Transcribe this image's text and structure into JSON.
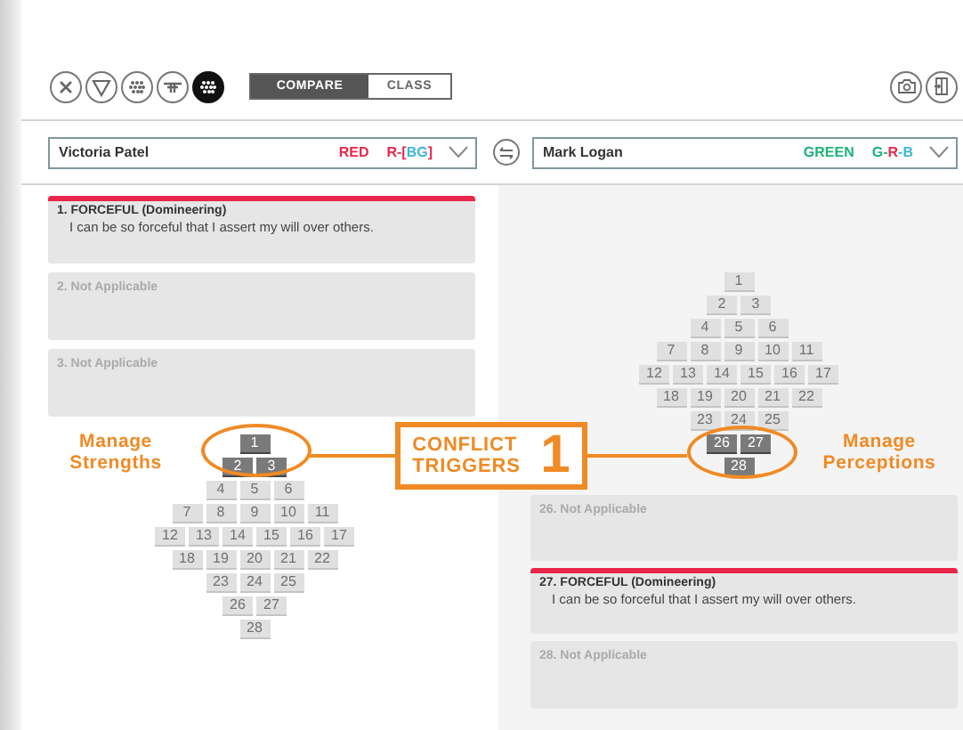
{
  "toolbar": {
    "filter_icons": [
      {
        "kind": "cross",
        "selected": false
      },
      {
        "kind": "triangle",
        "selected": false
      },
      {
        "kind": "cluster",
        "selected": false
      },
      {
        "kind": "bar",
        "selected": false
      },
      {
        "kind": "cluster",
        "selected": true
      }
    ],
    "view_tabs": [
      {
        "label": "COMPARE",
        "selected": true
      },
      {
        "label": "CLASS",
        "selected": false
      }
    ]
  },
  "people": [
    {
      "name": "Victoria Patel",
      "color_name": "RED",
      "color": "#e8264a",
      "code": [
        {
          "text": "R-[",
          "color": "#e8264a"
        },
        {
          "text": "BG",
          "color": "#3fb6e0"
        },
        {
          "text": "]",
          "color": "#e8264a"
        }
      ]
    },
    {
      "name": "Mark Logan",
      "color_name": "GREEN",
      "color": "#1db37a",
      "code": [
        {
          "text": "G-",
          "color": "#1db37a"
        },
        {
          "text": "R",
          "color": "#e8264a"
        },
        {
          "text": "-B",
          "color": "#3fb6e0"
        }
      ]
    }
  ],
  "left_panel": {
    "statements": [
      {
        "heading": "1. FORCEFUL (Domineering)",
        "body": "I can be so forceful that I assert my will over others.",
        "selected": true
      },
      {
        "heading": "2. Not Applicable",
        "selected": false
      },
      {
        "heading": "3. Not Applicable",
        "selected": false
      }
    ],
    "label": "Manage Strengths",
    "pyramid": [
      [
        {
          "label": "1",
          "selected": true
        }
      ],
      [
        {
          "label": "2",
          "selected": true
        },
        {
          "label": "3",
          "selected": true
        }
      ],
      [
        {
          "label": "4",
          "selected": false
        },
        {
          "label": "5",
          "selected": false
        },
        {
          "label": "6",
          "selected": false
        }
      ],
      [
        {
          "label": "7",
          "selected": false
        },
        {
          "label": "8",
          "selected": false
        },
        {
          "label": "9",
          "selected": false
        },
        {
          "label": "10",
          "selected": false
        },
        {
          "label": "11",
          "selected": false
        }
      ],
      [
        {
          "label": "12",
          "selected": false
        },
        {
          "label": "13",
          "selected": false
        },
        {
          "label": "14",
          "selected": false
        },
        {
          "label": "15",
          "selected": false
        },
        {
          "label": "16",
          "selected": false
        },
        {
          "label": "17",
          "selected": false
        }
      ],
      [
        {
          "label": "18",
          "selected": false
        },
        {
          "label": "19",
          "selected": false
        },
        {
          "label": "20",
          "selected": false
        },
        {
          "label": "21",
          "selected": false
        },
        {
          "label": "22",
          "selected": false
        }
      ],
      [
        {
          "label": "23",
          "selected": false
        },
        {
          "label": "24",
          "selected": false
        },
        {
          "label": "25",
          "selected": false
        }
      ],
      [
        {
          "label": "26",
          "selected": false
        },
        {
          "label": "27",
          "selected": false
        }
      ],
      [
        {
          "label": "28",
          "selected": false
        }
      ]
    ]
  },
  "conflict_triggers": {
    "label": "CONFLICT TRIGGERS",
    "count": "1"
  },
  "right_panel": {
    "label": "Manage Perceptions",
    "pyramid": [
      [
        {
          "label": "1",
          "selected": false
        }
      ],
      [
        {
          "label": "2",
          "selected": false
        },
        {
          "label": "3",
          "selected": false
        }
      ],
      [
        {
          "label": "4",
          "selected": false
        },
        {
          "label": "5",
          "selected": false
        },
        {
          "label": "6",
          "selected": false
        }
      ],
      [
        {
          "label": "7",
          "selected": false
        },
        {
          "label": "8",
          "selected": false
        },
        {
          "label": "9",
          "selected": false
        },
        {
          "label": "10",
          "selected": false
        },
        {
          "label": "11",
          "selected": false
        }
      ],
      [
        {
          "label": "12",
          "selected": false
        },
        {
          "label": "13",
          "selected": false
        },
        {
          "label": "14",
          "selected": false
        },
        {
          "label": "15",
          "selected": false
        },
        {
          "label": "16",
          "selected": false
        },
        {
          "label": "17",
          "selected": false
        }
      ],
      [
        {
          "label": "18",
          "selected": false
        },
        {
          "label": "19",
          "selected": false
        },
        {
          "label": "20",
          "selected": false
        },
        {
          "label": "21",
          "selected": false
        },
        {
          "label": "22",
          "selected": false
        }
      ],
      [
        {
          "label": "23",
          "selected": false
        },
        {
          "label": "24",
          "selected": false
        },
        {
          "label": "25",
          "selected": false
        }
      ],
      [
        {
          "label": "26",
          "selected": true
        },
        {
          "label": "27",
          "selected": true
        }
      ],
      [
        {
          "label": "28",
          "selected": true
        }
      ]
    ],
    "statements": [
      {
        "heading": "26. Not Applicable",
        "selected": false
      },
      {
        "heading": "27. FORCEFUL (Domineering)",
        "body": "I can be so forceful that I assert my will over others.",
        "selected": true
      },
      {
        "heading": "28. Not Applicable",
        "selected": false
      }
    ]
  }
}
